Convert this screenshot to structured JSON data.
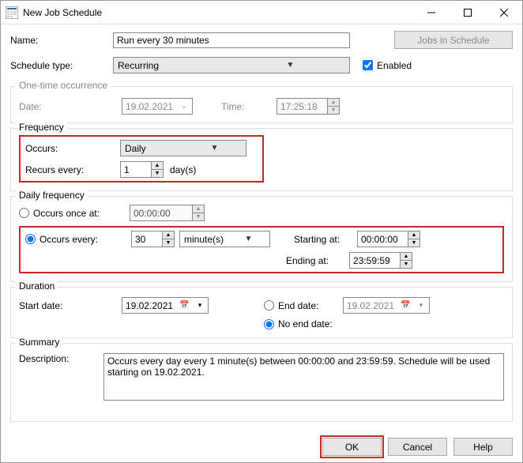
{
  "window": {
    "title": "New Job Schedule"
  },
  "labels": {
    "name": "Name:",
    "scheduleType": "Schedule type:",
    "enabled": "Enabled",
    "jobsInSchedule": "Jobs in Schedule",
    "oneTime": "One-time occurrence",
    "date": "Date:",
    "time": "Time:",
    "frequency": "Frequency",
    "occurs": "Occurs:",
    "recursEvery": "Recurs every:",
    "days": "day(s)",
    "dailyFrequency": "Daily frequency",
    "occursOnceAt": "Occurs once at:",
    "occursEvery": "Occurs every:",
    "startingAt": "Starting at:",
    "endingAt": "Ending at:",
    "duration": "Duration",
    "startDate": "Start date:",
    "endDate": "End date:",
    "noEndDate": "No end date:",
    "summary": "Summary",
    "description": "Description:",
    "ok": "OK",
    "cancel": "Cancel",
    "help": "Help"
  },
  "values": {
    "name": "Run every 30 minutes",
    "scheduleType": "Recurring",
    "enabled": true,
    "oneTimeDate": "19.02.2021",
    "oneTimeTime": "17:25:18",
    "occurs": "Daily",
    "recursEvery": "1",
    "occursOnceAt": "00:00:00",
    "occursEveryValue": "30",
    "occursEveryUnit": "minute(s)",
    "startingAt": "00:00:00",
    "endingAt": "23:59:59",
    "startDate": "19.02.2021",
    "endDate": "19.02.2021",
    "dailyMode": "every",
    "durationMode": "noEnd",
    "description": "Occurs every day every 1 minute(s) between 00:00:00 and 23:59:59. Schedule will be used starting on 19.02.2021."
  }
}
